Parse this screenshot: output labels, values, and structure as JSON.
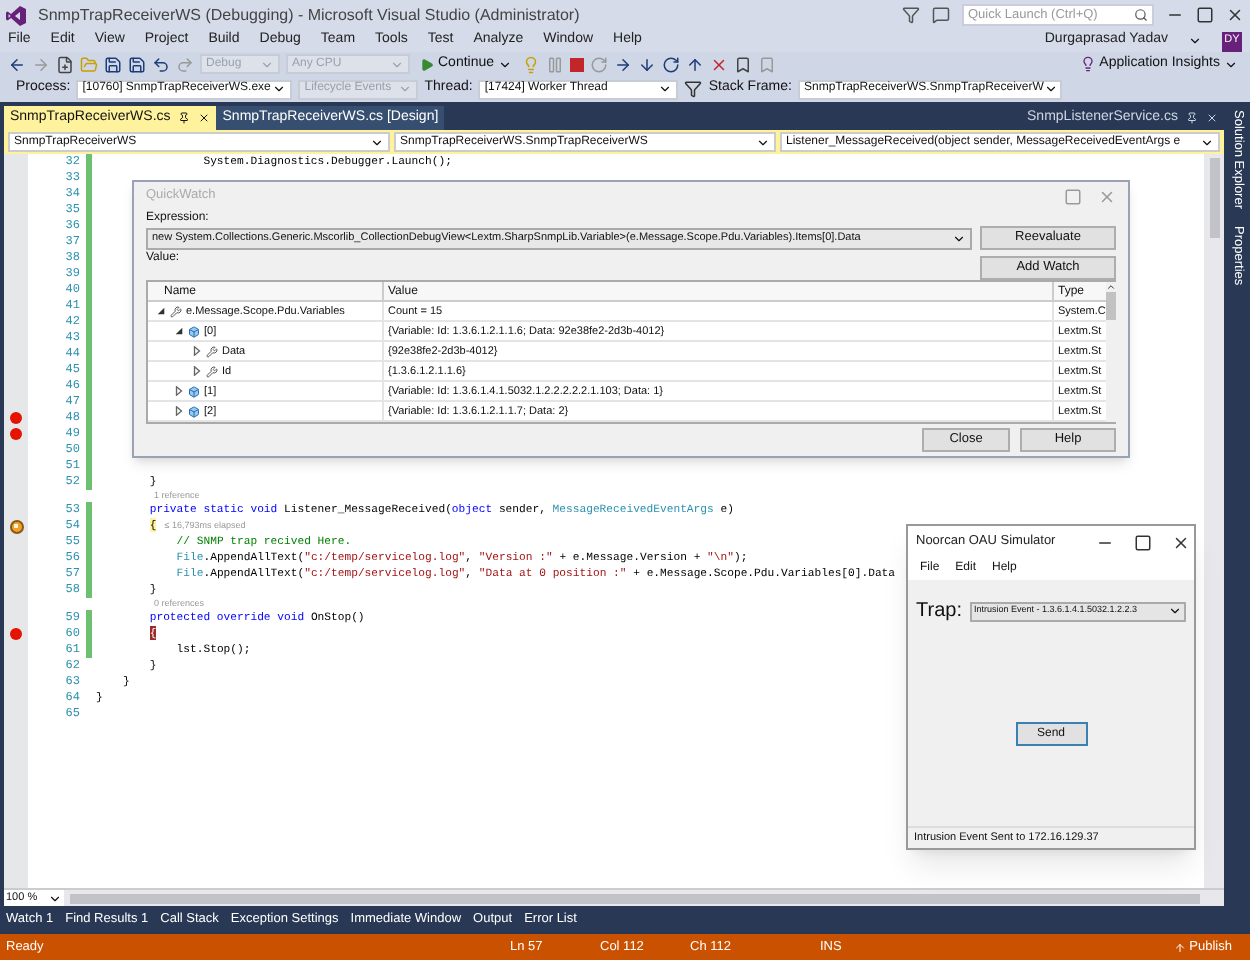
{
  "window": {
    "title": "SnmpTrapReceiverWS (Debugging) - Microsoft Visual Studio (Administrator)",
    "quick_launch": {
      "placeholder": "Quick Launch (Ctrl+Q)"
    },
    "user": {
      "name": "Durgaprasad Yadav",
      "initials": "DY"
    }
  },
  "menu": [
    "File",
    "Edit",
    "View",
    "Project",
    "Build",
    "Debug",
    "Team",
    "Tools",
    "Test",
    "Analyze",
    "Window",
    "Help"
  ],
  "toolbar": {
    "configuration": {
      "value": "Debug",
      "disabled": true
    },
    "platform": {
      "value": "Any CPU",
      "disabled": true
    },
    "continue": "Continue",
    "insights": "Application Insights"
  },
  "debug_location": {
    "process_label": "Process:",
    "process": "[10760] SnmpTrapReceiverWS.exe",
    "lifecycle": {
      "label": "Lifecycle Events",
      "disabled": true
    },
    "thread_label": "Thread:",
    "thread": "[17424] Worker Thread",
    "stack_frame_label": "Stack Frame:",
    "stack_frame": "SnmpTrapReceiverWS.SnmpTrapReceiverW"
  },
  "tabs": [
    {
      "label": "SnmpTrapReceiverWS.cs",
      "selected": true
    },
    {
      "label": "SnmpTrapReceiverWS.cs [Design]",
      "selected": false
    }
  ],
  "pinned_tab": {
    "label": "SnmpListenerService.cs"
  },
  "nav_bar": [
    "SnmpTrapReceiverWS",
    "SnmpTrapReceiverWS.SnmpTrapReceiverWS",
    "Listener_MessageReceived(object sender, MessageReceivedEventArgs e"
  ],
  "editor": {
    "zoom": "100 %",
    "lines": [
      {
        "kind": "code",
        "number": "32",
        "breakpoint": false,
        "current": false,
        "changed": true,
        "segments": [
          {
            "kind": "plain",
            "text": "                System.Diagnostics.Debugger.Launch();"
          }
        ]
      },
      {
        "kind": "code",
        "number": "33",
        "breakpoint": false,
        "current": false,
        "changed": true
      },
      {
        "kind": "code",
        "number": "34",
        "breakpoint": false,
        "current": false,
        "changed": true
      },
      {
        "kind": "code",
        "number": "35",
        "breakpoint": false,
        "current": false,
        "changed": true
      },
      {
        "kind": "code",
        "number": "36",
        "breakpoint": false,
        "current": false,
        "changed": true
      },
      {
        "kind": "code",
        "number": "37",
        "breakpoint": false,
        "current": false,
        "changed": true
      },
      {
        "kind": "code",
        "number": "38",
        "breakpoint": false,
        "current": false,
        "changed": true
      },
      {
        "kind": "code",
        "number": "39",
        "breakpoint": false,
        "current": false,
        "changed": true
      },
      {
        "kind": "code",
        "number": "40",
        "breakpoint": false,
        "current": false,
        "changed": true
      },
      {
        "kind": "code",
        "number": "41",
        "breakpoint": false,
        "current": false,
        "changed": true
      },
      {
        "kind": "code",
        "number": "42",
        "breakpoint": false,
        "current": false,
        "changed": true
      },
      {
        "kind": "code",
        "number": "43",
        "breakpoint": false,
        "current": false,
        "changed": true
      },
      {
        "kind": "code",
        "number": "44",
        "breakpoint": false,
        "current": false,
        "changed": true
      },
      {
        "kind": "code",
        "number": "45",
        "breakpoint": false,
        "current": false,
        "changed": true
      },
      {
        "kind": "code",
        "number": "46",
        "breakpoint": false,
        "current": false,
        "changed": true
      },
      {
        "kind": "code",
        "number": "47",
        "breakpoint": false,
        "current": false,
        "changed": true
      },
      {
        "kind": "code",
        "number": "48",
        "breakpoint": true,
        "current": false,
        "changed": true
      },
      {
        "kind": "code",
        "number": "49",
        "breakpoint": true,
        "current": false,
        "changed": true
      },
      {
        "kind": "code",
        "number": "50",
        "breakpoint": false,
        "current": false,
        "changed": true
      },
      {
        "kind": "code",
        "number": "51",
        "breakpoint": false,
        "current": false,
        "changed": true
      },
      {
        "kind": "code",
        "number": "52",
        "breakpoint": false,
        "current": false,
        "changed": true,
        "segments": [
          {
            "kind": "plain",
            "text": "        }"
          }
        ]
      },
      {
        "kind": "codelens",
        "text": "1 reference"
      },
      {
        "kind": "code",
        "number": "53",
        "breakpoint": false,
        "current": false,
        "changed": true,
        "segments": [
          {
            "kind": "keyword",
            "text": "        private static void"
          },
          {
            "kind": "plain",
            "text": " Listener_MessageReceived("
          },
          {
            "kind": "keyword",
            "text": "object"
          },
          {
            "kind": "plain",
            "text": " sender, "
          },
          {
            "kind": "type",
            "text": "MessageReceivedEventArgs"
          },
          {
            "kind": "plain",
            "text": " e)"
          }
        ]
      },
      {
        "kind": "code",
        "number": "54",
        "breakpoint": false,
        "current": true,
        "changed": true,
        "segments": [
          {
            "kind": "current",
            "text": "        {"
          }
        ],
        "perf_tip": "≤ 16,793ms elapsed"
      },
      {
        "kind": "code",
        "number": "55",
        "breakpoint": false,
        "current": false,
        "changed": true,
        "segments": [
          {
            "kind": "comment",
            "text": "            // SNMP trap recived Here."
          }
        ]
      },
      {
        "kind": "code",
        "number": "56",
        "breakpoint": false,
        "current": false,
        "changed": true,
        "segments": [
          {
            "kind": "type",
            "text": "            File"
          },
          {
            "kind": "plain",
            "text": ".AppendAllText("
          },
          {
            "kind": "string",
            "text": "\"c:/temp/servicelog.log\""
          },
          {
            "kind": "plain",
            "text": ", "
          },
          {
            "kind": "string",
            "text": "\"Version :\""
          },
          {
            "kind": "plain",
            "text": " + e.Message.Version + "
          },
          {
            "kind": "string",
            "text": "\"\\n\""
          },
          {
            "kind": "plain",
            "text": ");"
          }
        ]
      },
      {
        "kind": "code",
        "number": "57",
        "breakpoint": false,
        "current": false,
        "changed": true,
        "segments": [
          {
            "kind": "type",
            "text": "            File"
          },
          {
            "kind": "plain",
            "text": ".AppendAllText("
          },
          {
            "kind": "string",
            "text": "\"c:/temp/servicelog.log\""
          },
          {
            "kind": "plain",
            "text": ", "
          },
          {
            "kind": "string",
            "text": "\"Data at 0 position :\""
          },
          {
            "kind": "plain",
            "text": " + e.Message.Scope.Pdu.Variables[0].Data"
          }
        ]
      },
      {
        "kind": "code",
        "number": "58",
        "breakpoint": false,
        "current": false,
        "changed": true,
        "segments": [
          {
            "kind": "plain",
            "text": "        }"
          }
        ]
      },
      {
        "kind": "codelens",
        "text": "0 references"
      },
      {
        "kind": "code",
        "number": "59",
        "breakpoint": false,
        "current": false,
        "changed": true,
        "segments": [
          {
            "kind": "keyword",
            "text": "        protected override void"
          },
          {
            "kind": "plain",
            "text": " OnStop()"
          }
        ]
      },
      {
        "kind": "code",
        "number": "60",
        "breakpoint": true,
        "current": false,
        "changed": true,
        "segments": [
          {
            "kind": "breakpoint",
            "text": "        {"
          }
        ]
      },
      {
        "kind": "code",
        "number": "61",
        "breakpoint": false,
        "current": false,
        "changed": true,
        "segments": [
          {
            "kind": "plain",
            "text": "            lst.Stop();"
          }
        ]
      },
      {
        "kind": "code",
        "number": "62",
        "breakpoint": false,
        "current": false,
        "changed": false,
        "segments": [
          {
            "kind": "plain",
            "text": "        }"
          }
        ]
      },
      {
        "kind": "code",
        "number": "63",
        "breakpoint": false,
        "current": false,
        "changed": false,
        "segments": [
          {
            "kind": "plain",
            "text": "    }"
          }
        ]
      },
      {
        "kind": "code",
        "number": "64",
        "breakpoint": false,
        "current": false,
        "changed": false,
        "segments": [
          {
            "kind": "plain",
            "text": "}"
          }
        ]
      },
      {
        "kind": "code",
        "number": "65",
        "breakpoint": false,
        "current": false,
        "changed": false
      }
    ]
  },
  "side_tabs": [
    "Solution Explorer",
    "Properties"
  ],
  "quickwatch": {
    "title": "QuickWatch",
    "expression_label": "Expression:",
    "expression": "new System.Collections.Generic.Mscorlib_CollectionDebugView<Lextm.SharpSnmpLib.Variable>(e.Message.Scope.Pdu.Variables).Items[0].Data",
    "value_label": "Value:",
    "reevaluate": "Reevaluate",
    "add_watch": "Add Watch",
    "columns": [
      "Name",
      "Value",
      "Type"
    ],
    "rows": [
      {
        "kind": "property",
        "name": "e.Message.Scope.Pdu.Variables",
        "value": "Count = 15",
        "type": "System.C",
        "expanded": true,
        "children": [
          {
            "kind": "item",
            "name": "[0]",
            "value": "{Variable: Id: 1.3.6.1.2.1.1.6; Data: 92e38fe2-2d3b-4012}",
            "type": "Lextm.St",
            "expanded": true,
            "children": [
              {
                "kind": "property",
                "name": "Data",
                "value": "{92e38fe2-2d3b-4012}",
                "type": "Lextm.St",
                "expanded": false
              },
              {
                "kind": "property",
                "name": "Id",
                "value": "{1.3.6.1.2.1.1.6}",
                "type": "Lextm.St",
                "expanded": false
              }
            ]
          },
          {
            "kind": "item",
            "name": "[1]",
            "value": "{Variable: Id: 1.3.6.1.4.1.5032.1.2.2.2.2.2.1.103; Data: 1}",
            "type": "Lextm.St",
            "expanded": false
          },
          {
            "kind": "item",
            "name": "[2]",
            "value": "{Variable: Id: 1.3.6.1.2.1.1.7; Data: 2}",
            "type": "Lextm.St",
            "expanded": false
          }
        ]
      }
    ],
    "close": "Close",
    "help": "Help"
  },
  "simulator": {
    "title": "Noorcan OAU Simulator",
    "menu": [
      "File",
      "Edit",
      "Help"
    ],
    "trap_label": "Trap:",
    "trap": "Intrusion Event - 1.3.6.1.4.1.5032.1.2.2.3",
    "send": "Send",
    "status": "Intrusion Event Sent to 172.16.129.37"
  },
  "tool_tabs": [
    "Watch 1",
    "Find Results 1",
    "Call Stack",
    "Exception Settings",
    "Immediate Window",
    "Output",
    "Error List"
  ],
  "status_bar": {
    "state": "Ready",
    "line": "Ln 57",
    "column": "Col 112",
    "char": "Ch 112",
    "mode": "INS",
    "publish": "Publish"
  }
}
